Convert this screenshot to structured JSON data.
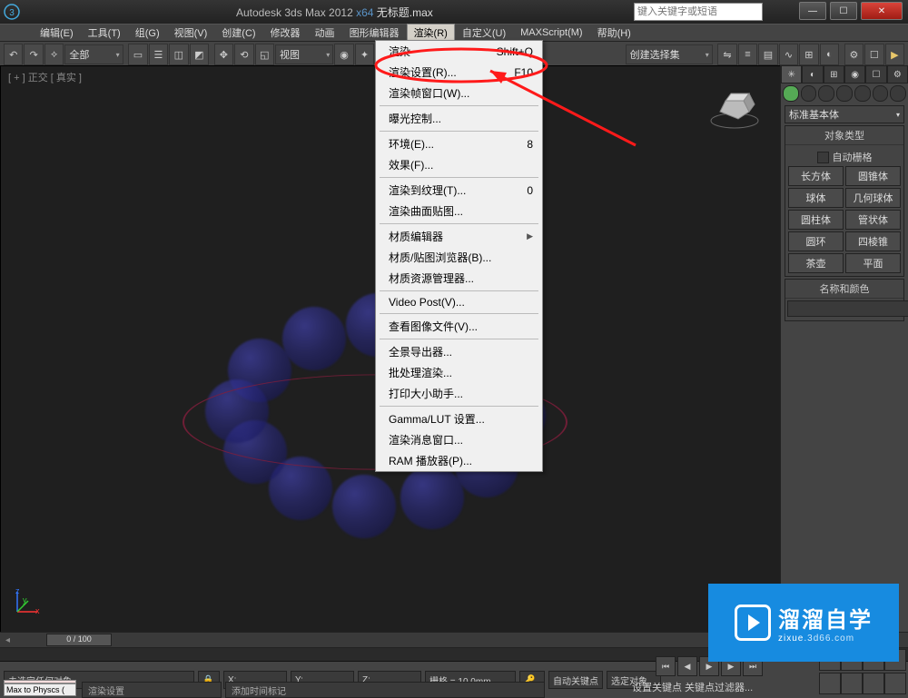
{
  "title": {
    "app": "Autodesk 3ds Max 2012 ",
    "x64": "x64",
    "sep": "   ",
    "file": "无标题.max"
  },
  "search_placeholder": "键入关键字或短语",
  "winbtns": {
    "min": "—",
    "max": "☐",
    "close": "✕"
  },
  "menubar": [
    "编辑(E)",
    "工具(T)",
    "组(G)",
    "视图(V)",
    "创建(C)",
    "修改器",
    "动画",
    "图形编辑器",
    "渲染(R)",
    "自定义(U)",
    "MAXScript(M)",
    "帮助(H)"
  ],
  "menubar_open_index": 8,
  "toolbar": {
    "all_label": "全部",
    "view_label": "视图",
    "set_label": "创建选择集"
  },
  "viewport": {
    "label": "[ + ] 正交 [ 真实 ]"
  },
  "render_menu": [
    {
      "t": "渲染",
      "s": "Shift+Q"
    },
    {
      "t": "渲染设置(R)...",
      "s": "F10"
    },
    {
      "t": "渲染帧窗口(W)..."
    },
    {
      "sep": true
    },
    {
      "t": "曝光控制..."
    },
    {
      "sep": true
    },
    {
      "t": "环境(E)...",
      "s": "8"
    },
    {
      "t": "效果(F)..."
    },
    {
      "sep": true
    },
    {
      "t": "渲染到纹理(T)...",
      "s": "0"
    },
    {
      "t": "渲染曲面贴图..."
    },
    {
      "sep": true
    },
    {
      "t": "材质编辑器",
      "arr": true
    },
    {
      "t": "材质/贴图浏览器(B)..."
    },
    {
      "t": "材质资源管理器..."
    },
    {
      "sep": true
    },
    {
      "t": "Video Post(V)..."
    },
    {
      "sep": true
    },
    {
      "t": "查看图像文件(V)..."
    },
    {
      "sep": true
    },
    {
      "t": "全景导出器..."
    },
    {
      "t": "批处理渲染..."
    },
    {
      "t": "打印大小助手..."
    },
    {
      "sep": true
    },
    {
      "t": "Gamma/LUT 设置..."
    },
    {
      "t": "渲染消息窗口..."
    },
    {
      "t": "RAM 播放器(P)..."
    }
  ],
  "cmdpanel": {
    "primitive_dd": "标准基本体",
    "rollout_objtype": "对象类型",
    "autogrid": "自动栅格",
    "buttons": [
      [
        "长方体",
        "圆锥体"
      ],
      [
        "球体",
        "几何球体"
      ],
      [
        "圆柱体",
        "管状体"
      ],
      [
        "圆环",
        "四棱锥"
      ],
      [
        "茶壶",
        "平面"
      ]
    ],
    "rollout_name": "名称和颜色"
  },
  "timeline": {
    "range": "0 / 100"
  },
  "status": {
    "sel": "未选定任何对象",
    "x": "X:",
    "y": "Y:",
    "z": "Z:",
    "grid": "栅格 = 10.0mm",
    "autokey": "自动关键点",
    "selset": "选定对象",
    "setkey": "设置关键点",
    "keyfilter": "关键点过滤器..."
  },
  "prompt": {
    "a": "渲染设置",
    "b": "添加时间标记"
  },
  "maxscript": {
    "a": "",
    "b": "Max to Physcs ("
  },
  "watermark": {
    "big": "溜溜自学",
    "small": "zixue",
    "domain": ".3d66.com"
  }
}
